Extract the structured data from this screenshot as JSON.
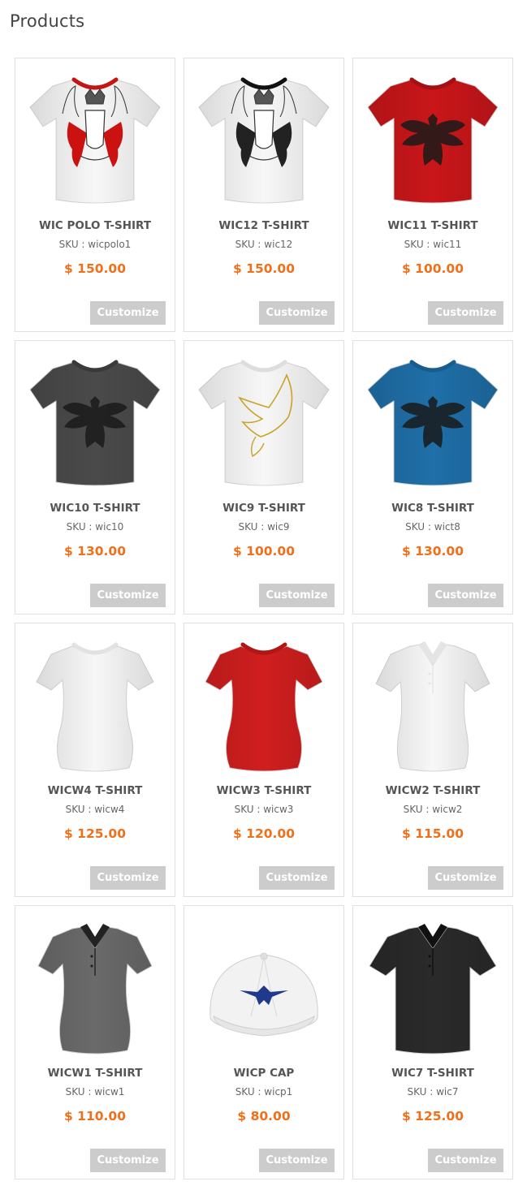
{
  "page": {
    "title": "Products"
  },
  "products": [
    {
      "name": "WIC POLO T-SHIRT",
      "sku": "SKU : wicpolo1",
      "price": "$ 150.00",
      "button": "Customize",
      "image": "tshirt-crest-red-icon",
      "garment": "tee",
      "color": "#f7f7f7",
      "collar": "#c41414",
      "print": "crest-red"
    },
    {
      "name": "WIC12 T-SHIRT",
      "sku": "SKU : wic12",
      "price": "$ 150.00",
      "button": "Customize",
      "image": "tshirt-crest-black-icon",
      "garment": "tee",
      "color": "#f7f7f7",
      "collar": "#111111",
      "print": "crest-black"
    },
    {
      "name": "WIC11 T-SHIRT",
      "sku": "SKU : wic11",
      "price": "$ 100.00",
      "button": "Customize",
      "image": "tshirt-eagle-red-icon",
      "garment": "tee",
      "color": "#c9161a",
      "collar": "#a51013",
      "print": "eagle-dark"
    },
    {
      "name": "WIC10 T-SHIRT",
      "sku": "SKU : wic10",
      "price": "$ 130.00",
      "button": "Customize",
      "image": "tshirt-eagle-gray-icon",
      "garment": "tee",
      "color": "#4a4a4a",
      "collar": "#3a3a3a",
      "print": "eagle-dark"
    },
    {
      "name": "WIC9 T-SHIRT",
      "sku": "SKU : wic9",
      "price": "$ 100.00",
      "button": "Customize",
      "image": "tshirt-eagle-gold-icon",
      "garment": "tee",
      "color": "#f7f7f7",
      "collar": "#dddddd",
      "print": "eagle-gold"
    },
    {
      "name": "WIC8 T-SHIRT",
      "sku": "SKU : wict8",
      "price": "$ 130.00",
      "button": "Customize",
      "image": "tshirt-eagle-blue-icon",
      "garment": "tee",
      "color": "#1f6fa8",
      "collar": "#185d8e",
      "print": "eagle-dark"
    },
    {
      "name": "WICW4 T-SHIRT",
      "sku": "SKU : wicw4",
      "price": "$ 125.00",
      "button": "Customize",
      "image": "women-tshirt-white-icon",
      "garment": "women",
      "color": "#f7f7f7",
      "collar": "#e2e2e2",
      "print": "none"
    },
    {
      "name": "WICW3 T-SHIRT",
      "sku": "SKU : wicw3",
      "price": "$ 120.00",
      "button": "Customize",
      "image": "women-tshirt-red-icon",
      "garment": "women",
      "color": "#d01e1e",
      "collar": "#b01616",
      "print": "none"
    },
    {
      "name": "WICW2 T-SHIRT",
      "sku": "SKU : wicw2",
      "price": "$ 115.00",
      "button": "Customize",
      "image": "women-polo-white-icon",
      "garment": "polo-women",
      "color": "#f7f7f7",
      "collar": "#e4e4e4",
      "print": "none"
    },
    {
      "name": "WICW1 T-SHIRT",
      "sku": "SKU : wicw1",
      "price": "$ 110.00",
      "button": "Customize",
      "image": "women-polo-gray-icon",
      "garment": "polo-women",
      "color": "#6a6a6a",
      "collar": "#222222",
      "print": "none"
    },
    {
      "name": "WICP CAP",
      "sku": "SKU : wicp1",
      "price": "$ 80.00",
      "button": "Customize",
      "image": "cap-eagle-icon",
      "garment": "cap",
      "color": "#f2f2f2",
      "collar": "#d8d8d8",
      "print": "eagle-blue"
    },
    {
      "name": "WIC7 T-SHIRT",
      "sku": "SKU : wic7",
      "price": "$ 125.00",
      "button": "Customize",
      "image": "polo-black-icon",
      "garment": "polo",
      "color": "#2a2a2a",
      "collar": "#111111",
      "print": "none"
    }
  ]
}
